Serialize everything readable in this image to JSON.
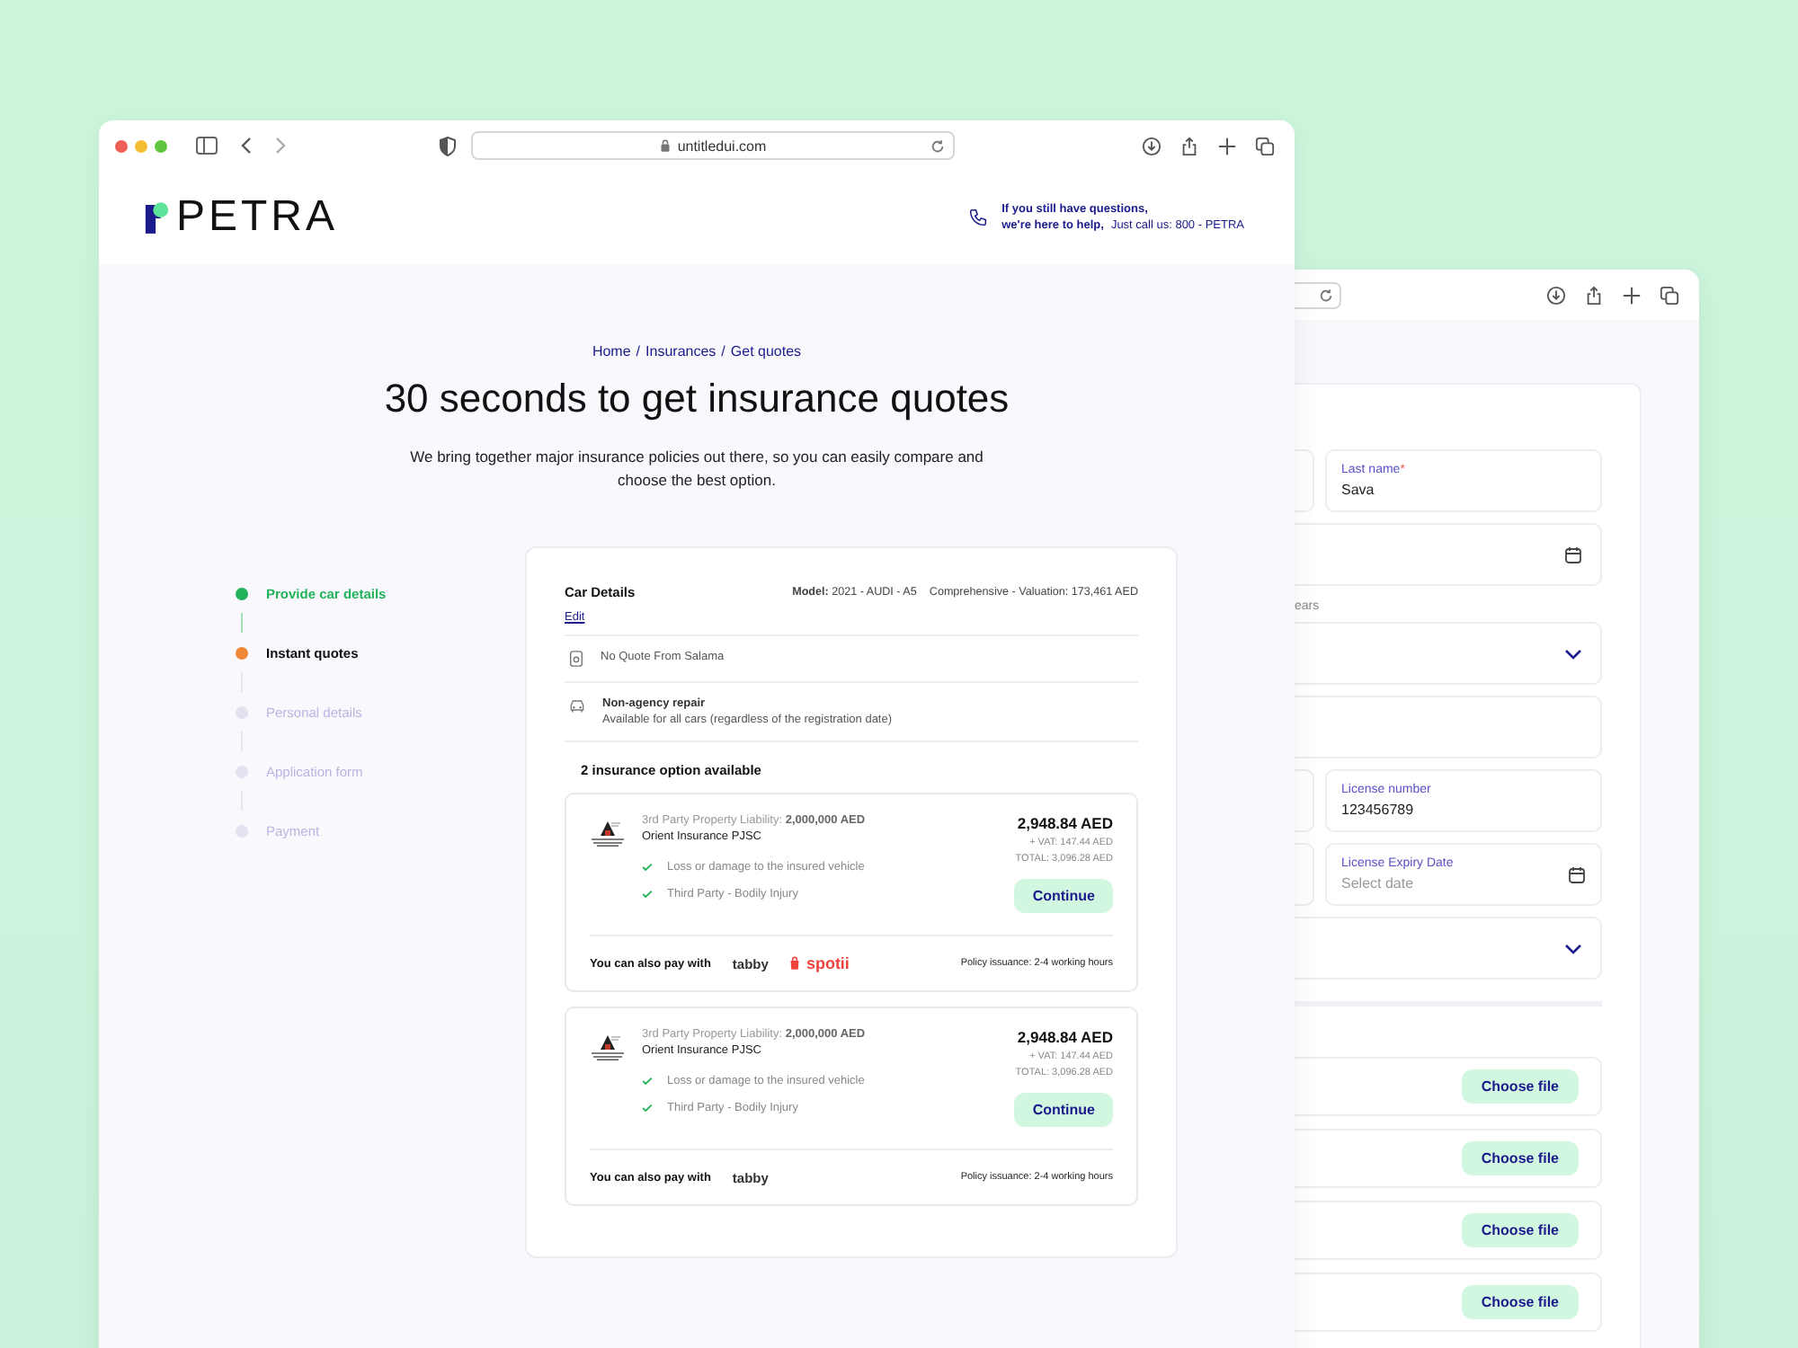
{
  "back_window": {
    "rows": [
      {
        "kind": "split",
        "label": "Last name",
        "required_mark": "*",
        "value": "Sava"
      },
      {
        "kind": "date"
      },
      {
        "kind": "hint",
        "text": "ears"
      },
      {
        "kind": "select"
      },
      {
        "kind": "text"
      },
      {
        "kind": "split",
        "label": "License number",
        "value": "123456789"
      },
      {
        "kind": "split_date",
        "label": "License Expiry Date",
        "placeholder": "Select date"
      },
      {
        "kind": "select"
      }
    ],
    "uploads": [
      {
        "button": "Choose file"
      },
      {
        "button": "Choose file"
      },
      {
        "button": "Choose file"
      },
      {
        "button": "Choose file"
      }
    ]
  },
  "browser": {
    "url": "untitledui.com"
  },
  "header": {
    "logo": "PETRA",
    "help_line_1": "If you still have questions,",
    "help_line_2": "we're here to help,",
    "help_call": "Just call us: 800 - PETRA"
  },
  "breadcrumb": {
    "items": [
      "Home",
      "Insurances",
      "Get quotes"
    ],
    "separator": "/"
  },
  "title": "30 seconds to get insurance quotes",
  "subtitle": "We bring together major insurance policies out there, so you can easily compare and choose the best option.",
  "steps": [
    {
      "label": "Provide car details",
      "completed": true,
      "selected": false
    },
    {
      "label": "Instant quotes",
      "completed": false,
      "selected": true
    },
    {
      "label": "Personal details",
      "completed": false,
      "selected": false
    },
    {
      "label": "Application form",
      "completed": false,
      "selected": false
    },
    {
      "label": "Payment",
      "completed": false,
      "selected": false
    }
  ],
  "car_details": {
    "title": "Car Details",
    "model_label": "Model:",
    "model": "2021 - AUDI - A5",
    "coverage": "Comprehensive - Valuation: 173,461 AED",
    "edit": "Edit"
  },
  "notices": [
    {
      "kind": "document",
      "title": "No Quote From Salama"
    },
    {
      "kind": "car",
      "title": "Non-agency repair",
      "detail": "Available for all cars (regardless of the registration date)"
    }
  ],
  "options_heading": "2 insurance option available",
  "quotes": [
    {
      "liability_label": "3rd Party Property Liability:",
      "liability": "2,000,000 AED",
      "insurer": "Orient Insurance PJSC",
      "features": [
        "Loss or damage to the insured vehicle",
        "Third Party - Bodily Injury"
      ],
      "price": "2,948.84 AED",
      "vat": "+ VAT: 147.44 AED",
      "total": "TOTAL: 3,096.28 AED",
      "button": "Continue",
      "pay_label": "You can also pay with",
      "pay_options": [
        {
          "kind": "tabby",
          "name": "tabby"
        },
        {
          "kind": "spotii",
          "name": "spotii"
        }
      ],
      "issuance": "Policy issuance: 2-4 working hours"
    },
    {
      "liability_label": "3rd Party Property Liability:",
      "liability": "2,000,000 AED",
      "insurer": "Orient Insurance PJSC",
      "features": [
        "Loss or damage to the insured vehicle",
        "Third Party - Bodily Injury"
      ],
      "price": "2,948.84 AED",
      "vat": "+ VAT: 147.44 AED",
      "total": "TOTAL: 3,096.28 AED",
      "button": "Continue",
      "pay_label": "You can also pay with",
      "pay_options": [
        {
          "kind": "tabby",
          "name": "tabby"
        }
      ],
      "issuance": "Policy issuance: 2-4 working hours"
    }
  ]
}
